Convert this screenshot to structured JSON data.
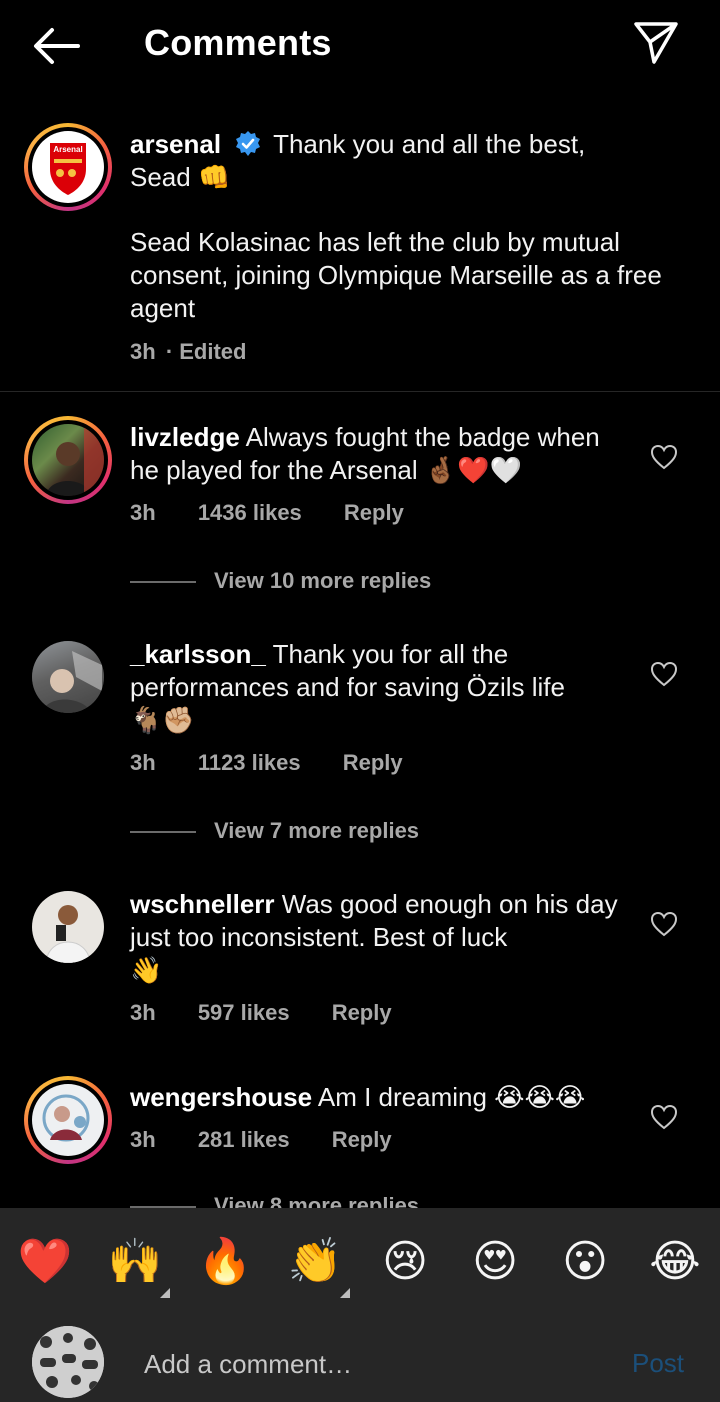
{
  "header": {
    "title": "Comments",
    "back_icon": "arrow-left-icon",
    "share_icon": "paper-plane-icon"
  },
  "caption": {
    "username": "arsenal",
    "verified_icon": "verified-badge-icon",
    "line1": "Thank you and all the best,",
    "line2": "Sead",
    "line2_emoji": "👊",
    "body": "Sead Kolasinac has left the club by mutual consent, joining Olympique Marseille as a free agent",
    "time": "3h",
    "edited": "· Edited",
    "avatar_logo_text": "Arsenal"
  },
  "comments": [
    {
      "username": "livzledge",
      "text": "Always fought the badge when he played for the Arsenal",
      "emojis": "🤞🏾❤️🤍",
      "time": "3h",
      "likes": "1436 likes",
      "reply": "Reply",
      "view_replies": "View 10 more replies"
    },
    {
      "username": "_karlsson_",
      "text": "Thank you for all the performances and for saving Özils life",
      "emojis": "🐐✊🏼",
      "time": "3h",
      "likes": "1123 likes",
      "reply": "Reply",
      "view_replies": "View 7 more replies"
    },
    {
      "username": "wschnellerr",
      "text": "Was good enough on his day just too inconsistent. Best of luck",
      "emojis": "👋",
      "time": "3h",
      "likes": "597 likes",
      "reply": "Reply"
    },
    {
      "username": "wengershouse",
      "text": "Am I dreaming",
      "emojis": "😭😭😭",
      "time": "3h",
      "likes": "281 likes",
      "reply": "Reply",
      "view_replies": "View 8 more replies"
    }
  ],
  "quick_reactions": [
    "❤️",
    "🙌",
    "🔥",
    "👏",
    "😢",
    "😍",
    "😮",
    "😂"
  ],
  "composer": {
    "placeholder": "Add a comment…",
    "post_label": "Post"
  },
  "colors": {
    "background": "#000000",
    "bar": "#262626",
    "muted": "#a8a8a8",
    "verified": "#3897f0",
    "post_disabled": "#1b4f7a"
  }
}
